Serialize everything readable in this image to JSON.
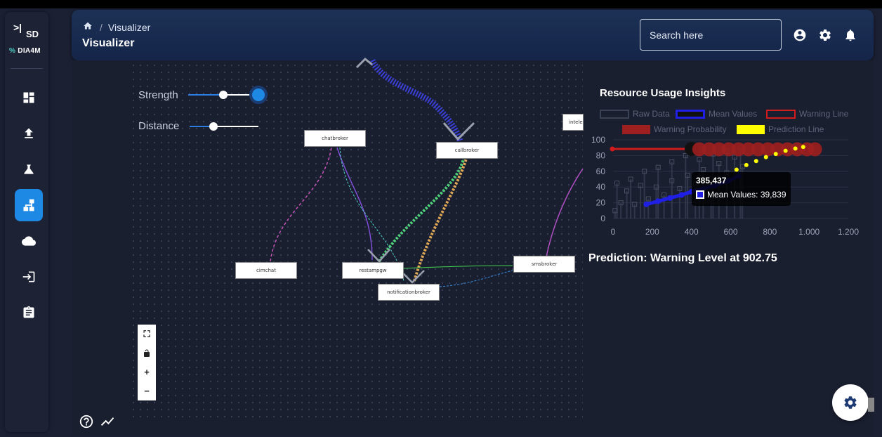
{
  "sidebar": {
    "toggle_glyph": ">|",
    "logo_mark": "SD",
    "brand_name": "DIA4M",
    "items": [
      {
        "icon": "dashboard-icon"
      },
      {
        "icon": "upload-icon"
      },
      {
        "icon": "flask-icon"
      },
      {
        "icon": "hierarchy-icon",
        "active": true
      },
      {
        "icon": "cloud-icon"
      },
      {
        "icon": "login-icon"
      },
      {
        "icon": "clipboard-icon"
      }
    ]
  },
  "header": {
    "breadcrumb": "Visualizer",
    "separator": "/",
    "title": "Visualizer",
    "search_placeholder": "Search here"
  },
  "controls": {
    "strength_label": "Strength",
    "distance_label": "Distance",
    "strength_value": 0.55,
    "distance_value": 0.33
  },
  "graph": {
    "nodes": [
      "chatbroker",
      "callbroker",
      "intelep",
      "cimchat",
      "restampgw",
      "notificationbroker",
      "smsbroker"
    ]
  },
  "zoom": {
    "fit": "⛶",
    "lock": "🔓",
    "plus": "+",
    "minus": "−"
  },
  "chart_data": {
    "type": "scatter",
    "title": "Resource Usage Insights",
    "legend": [
      "Raw Data",
      "Mean Values",
      "Warning Line",
      "Warning Probability",
      "Prediction Line"
    ],
    "colors": {
      "raw": "#3a4256",
      "mean": "#1f1fe6",
      "warning_line": "#d01c1c",
      "warning_prob": "#9e1f1f",
      "prediction": "#ffff00"
    },
    "x_ticks": [
      "0",
      "200",
      "400",
      "600",
      "800",
      "1.000",
      "1.200"
    ],
    "y_ticks": [
      "0",
      "20",
      "40",
      "60",
      "80",
      "100"
    ],
    "xlim": [
      0,
      1200
    ],
    "ylim": [
      0,
      100
    ],
    "series": [
      {
        "name": "Mean Values",
        "x": [
          170,
          230,
          290,
          350,
          400,
          460,
          520,
          590,
          640
        ],
        "y": [
          18,
          22,
          26,
          30,
          34,
          38,
          42,
          48,
          54
        ]
      },
      {
        "name": "Prediction Line",
        "x": [
          630,
          680,
          730,
          780,
          830,
          880,
          930,
          970
        ],
        "y": [
          62,
          68,
          73,
          78,
          82,
          86,
          89,
          91
        ]
      },
      {
        "name": "Warning Line",
        "x": [
          0,
          400
        ],
        "y": [
          88,
          88
        ]
      },
      {
        "name": "Warning Probability",
        "x": [
          440,
          490,
          540,
          590,
          640,
          690,
          740,
          790,
          840,
          890,
          940,
          990,
          1030
        ],
        "y": [
          88,
          88,
          88,
          88,
          88,
          88,
          88,
          88,
          88,
          88,
          88,
          88,
          88
        ]
      }
    ],
    "tooltip": {
      "title": "385,437",
      "series_label": "Mean Values: 39,839"
    }
  },
  "prediction_text": "Prediction: Warning Level at 902.75"
}
